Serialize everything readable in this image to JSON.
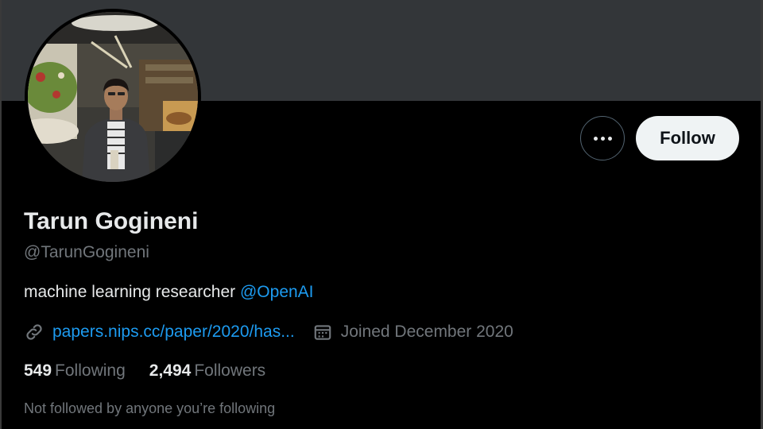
{
  "profile": {
    "name": "Tarun Gogineni",
    "handle": "@TarunGogineni",
    "bio_text": "machine learning researcher ",
    "bio_mention": "@OpenAI",
    "website": "papers.nips.cc/paper/2020/has...",
    "joined": "Joined December 2020",
    "following_count": "549",
    "following_label": "Following",
    "followers_count": "2,494",
    "followers_label": "Followers",
    "not_followed_text": "Not followed by anyone you’re following"
  },
  "actions": {
    "follow_label": "Follow",
    "more_icon": "more-horizontal-icon"
  },
  "icons": {
    "link": "link-icon",
    "calendar": "calendar-icon"
  },
  "colors": {
    "background": "#000000",
    "banner": "#333639",
    "accent": "#1d9bf0",
    "secondary_text": "#71767b",
    "follow_button": "#eff3f4"
  }
}
